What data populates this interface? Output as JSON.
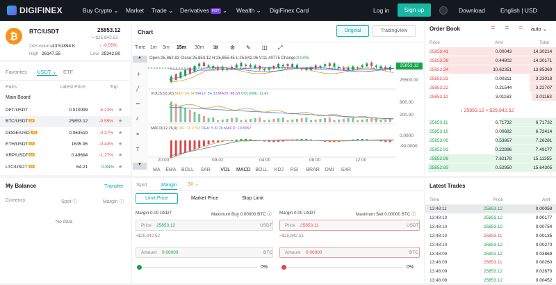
{
  "nav": {
    "brand": "DIGIFINEX",
    "buy_crypto": "Buy Crypto",
    "market": "Market",
    "trade": "Trade",
    "derivatives": "Derivatives",
    "hot": "HOT",
    "wealth": "Wealth",
    "card": "DigiFinex Card",
    "login": "Log in",
    "signup": "Sign up",
    "download": "Download",
    "lang": "English | USD"
  },
  "ticker": {
    "pair": "BTC/USDT",
    "price": "25853.12",
    "approx": "≈ $25,842.52",
    "change": "-0.55%",
    "vol_label": "24H volume",
    "vol": "13.51894 K",
    "high_label": "High",
    "high": "26147.55",
    "low_label": "Low",
    "low": "25342.80"
  },
  "market_tabs": {
    "favorites": "Favorites",
    "usdt": "USDT",
    "etf": "ETF"
  },
  "pairs_header": {
    "pairs": "Pairs",
    "last": "Latest Price",
    "top": "Top"
  },
  "main_board": "Main Board",
  "pairs": [
    {
      "name": "DFT/USDT",
      "badge": "",
      "price": "0.010099",
      "change": "-5.23%",
      "color": "#e04848"
    },
    {
      "name": "BTC/USDT",
      "badge": "3X",
      "price": "25853.12",
      "change": "-0.55%",
      "color": "#e04848"
    },
    {
      "name": "DOGE/USDT",
      "badge": "3X",
      "price": "0.063519",
      "change": "-0.37%",
      "color": "#e04848"
    },
    {
      "name": "ETH/USDT",
      "badge": "3X",
      "price": "1635.95",
      "change": "-0.43%",
      "color": "#e04848"
    },
    {
      "name": "XRP/USDT",
      "badge": "3X",
      "price": "0.49694",
      "change": "-1.77%",
      "color": "#e04848"
    },
    {
      "name": "LTC/USDT",
      "badge": "3X",
      "price": "64.21",
      "change": "0.84%",
      "color": "#16a34a"
    }
  ],
  "balance": {
    "title": "My Balance",
    "transfer": "Transfer",
    "currency": "Currency",
    "spot": "Spot",
    "margin": "Margin",
    "no_data": "No data"
  },
  "chart": {
    "title": "Chart",
    "original": "Original",
    "tradingview": "TradingView",
    "intervals": [
      "Time",
      "1m",
      "5m",
      "15m",
      "30m",
      "1h"
    ],
    "ohlc": "Open:25,862.83   Close:25,853.12   H:25,855.45   L:25,842.06   V:11.40775   Change:",
    "change": "0.04%",
    "price_tag": "25853.12",
    "y1": "25500.00",
    "vol_label": "VOL(5,10,20)",
    "ma5": "MA5: 64.34",
    "ma10": "MA10: 54.33",
    "ma20": "MA20: 48.58",
    "volume": "VOLUME: 11.41",
    "vol_y1": "800.00",
    "vol_y2": "200.00",
    "macd_label": "MACD(12,26,9)",
    "dif": "DIF: 11.2753",
    "dea": "DEA: 5.8726",
    "macd": "MACD: 10.8057",
    "macd_y1": "0.0000",
    "macd_y2": "-90.0000",
    "x_ticks": [
      "20:00",
      "09-02",
      "04:00",
      "08:00",
      "12:00"
    ],
    "indicators": [
      "MA",
      "EMA",
      "BOLL",
      "SAR",
      "VOL",
      "MACD",
      "BOLL",
      "KDJ",
      "RSI",
      "BRAR",
      "DMI",
      "SAR"
    ]
  },
  "order": {
    "spot": "Spot",
    "margin": "Margin",
    "lev": "3X",
    "limit": "Limit Price",
    "market": "Market Price",
    "stop": "Stop Limit",
    "margin_left": "Margin 0.00 USDT",
    "max_buy": "Maximum Buy 0.00000 BTC",
    "margin_right": "Margin 0.00 USDT",
    "max_sell": "Maximum Sell 0.00000 BTC",
    "price_label": "Price",
    "buy_price": "25853.12",
    "sell_price": "25853.11",
    "usdt": "USDT",
    "buy_approx": "≈$25,842.52",
    "sell_approx": "≈$25,842.51",
    "amount_label": "Amount",
    "buy_amount": "0.00000",
    "sell_amount": "0.00000",
    "btc": "BTC",
    "pct": "0%"
  },
  "book": {
    "title": "Order Book",
    "auto": "auto",
    "price": "Price",
    "amt": "Amt",
    "total": "Total",
    "asks": [
      [
        "25853.41",
        "0.00043",
        "14.30214"
      ],
      [
        "25853.38",
        "0.44802",
        "14.30171"
      ],
      [
        "25853.34",
        "10.62351",
        "13.85369"
      ],
      [
        "25853.33",
        "0.00311",
        "3.23018"
      ],
      [
        "25853.22",
        "0.21544",
        "3.22707"
      ],
      [
        "25853.12",
        "3.01163",
        "3.01163"
      ]
    ],
    "mid": "25853.12",
    "mid_approx": "≈ $25,842.52",
    "bids": [
      [
        "25853.11",
        "6.71732",
        "6.71732"
      ],
      [
        "25853.10",
        "0.00682",
        "6.72414"
      ],
      [
        "25853.00",
        "0.53867",
        "7.26281"
      ],
      [
        "25852.93",
        "0.22896",
        "7.49177"
      ],
      [
        "25852.89",
        "7.62178",
        "15.11355"
      ],
      [
        "25852.85",
        "0.52950",
        "15.64305"
      ]
    ]
  },
  "trades": {
    "title": "Latest Trades",
    "time": "Time",
    "price": "Price",
    "amt": "Amt",
    "rows": [
      [
        "13:48:11",
        "25853.12",
        "0.00058",
        "#16a34a"
      ],
      [
        "13:48:10",
        "25853.12",
        "0.00177",
        "#16a34a"
      ],
      [
        "13:48:10",
        "25853.12",
        "0.00754",
        "#16a34a"
      ],
      [
        "13:48:10",
        "25853.11",
        "0.00135",
        "#e04848"
      ],
      [
        "13:48:10",
        "25853.12",
        "0.00270",
        "#16a34a"
      ],
      [
        "13:48:09",
        "25853.12",
        "0.03869",
        "#16a34a"
      ],
      [
        "13:48:09",
        "25853.11",
        "0.00260",
        "#e04848"
      ],
      [
        "13:48:09",
        "25853.12",
        "0.02670",
        "#16a34a"
      ],
      [
        "13:48:08",
        "25853.12",
        "0.00452",
        "#16a34a"
      ]
    ]
  }
}
